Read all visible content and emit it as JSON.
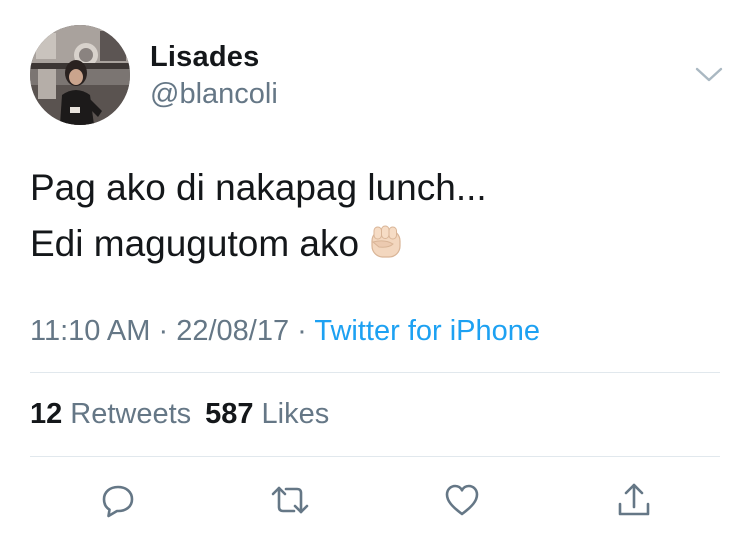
{
  "author": {
    "display_name": "Lisades",
    "handle": "@blancoli"
  },
  "tweet": {
    "lines": [
      "Pag ako di nakapag lunch...",
      "Edi magugutom ako"
    ],
    "emoji": "raised-fist-light-skin-tone"
  },
  "meta": {
    "time": "11:10 AM",
    "date": "22/08/17",
    "separator": "·",
    "source": "Twitter for iPhone"
  },
  "stats": {
    "retweets_count": "12",
    "retweets_label": "Retweets",
    "likes_count": "587",
    "likes_label": "Likes"
  },
  "actions": [
    "reply-icon",
    "retweet-icon",
    "like-icon",
    "share-icon"
  ],
  "colors": {
    "text": "#14171a",
    "secondary": "#657786",
    "link": "#1da1f2",
    "divider": "#e1e8ed"
  }
}
